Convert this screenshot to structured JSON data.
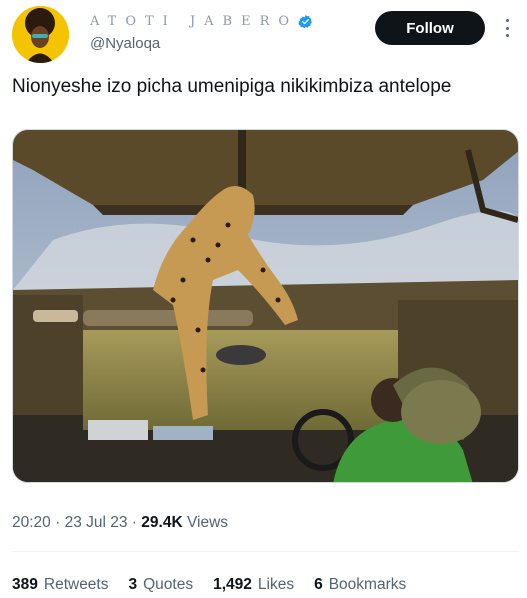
{
  "author": {
    "display_name": "ATOTI JABERO",
    "handle": "@Nyaloqa",
    "verified_color": "#1d9bf0"
  },
  "follow_label": "Follow",
  "tweet_text": "Nionyeshe izo picha umenipiga nikikimbiza antelope",
  "meta": {
    "time": "20:20",
    "sep1": " · ",
    "date": "23 Jul 23",
    "sep2": " · ",
    "views_count": "29.4K",
    "views_label": " Views"
  },
  "stats": [
    {
      "count": "389",
      "label": "Retweets"
    },
    {
      "count": "3",
      "label": "Quotes"
    },
    {
      "count": "1,492",
      "label": "Likes"
    },
    {
      "count": "6",
      "label": "Bookmarks"
    }
  ],
  "colors": {
    "accent": "#0f1419",
    "secondary_text": "#536471",
    "avatar_bg": "#f5c400"
  }
}
